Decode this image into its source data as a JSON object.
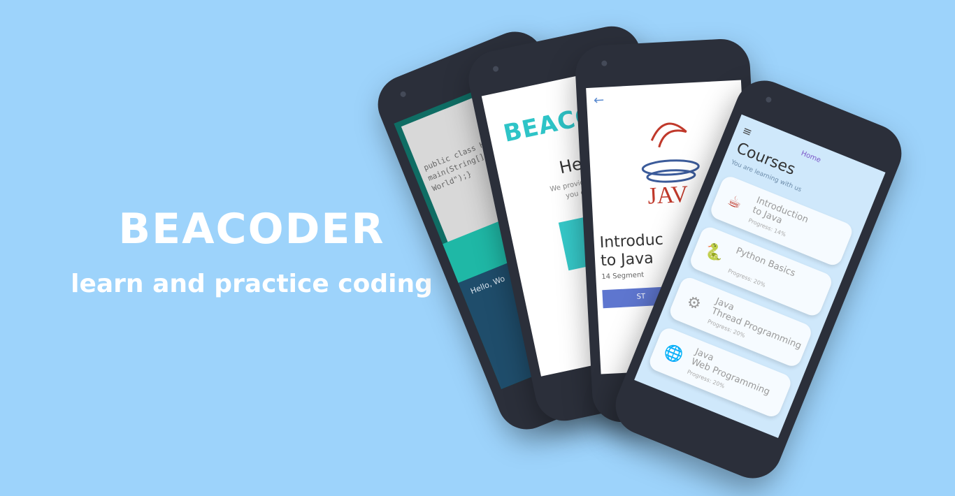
{
  "brand": {
    "logo": "BEACODER",
    "tagline": "learn and practice coding"
  },
  "phone1": {
    "code": "public class HelloWo\nmain(String[] args) {\nWorld\");}",
    "output": "Hello, Wo"
  },
  "phone2": {
    "logo": "BEACO",
    "heading": "Hey! ",
    "text": "We provides valu\nyou can j"
  },
  "phone3": {
    "title": "Introduc\nto Java",
    "segments": "14 Segment",
    "start": "ST"
  },
  "phone4": {
    "home": "Home",
    "title": "Courses",
    "subtitle": "You are learning with us",
    "courses": [
      {
        "title": "Introduction\nto Java",
        "progress": "Progress: 14%",
        "icon": "java-icon"
      },
      {
        "title": "Python Basics",
        "progress": "Progress: 20%",
        "icon": "python-icon"
      },
      {
        "title": "Java\nThread Programming",
        "progress": "Progress: 20%",
        "icon": "thread-icon"
      },
      {
        "title": "Java\nWeb Programming",
        "progress": "Progress: 20%",
        "icon": "web-icon"
      }
    ]
  }
}
